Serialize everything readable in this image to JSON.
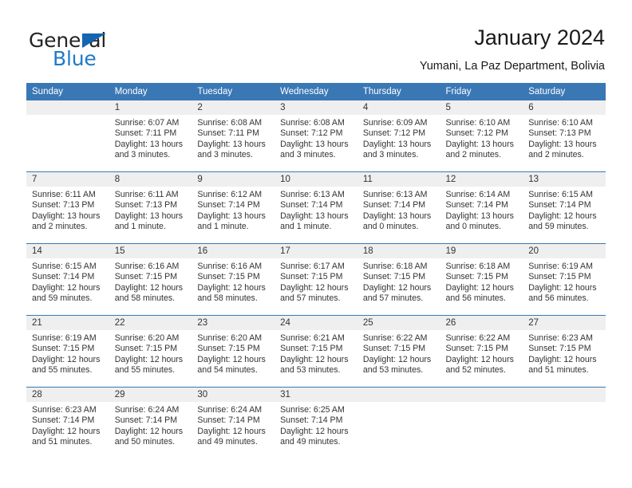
{
  "brand": {
    "name_part1": "General",
    "name_part2": "Blue",
    "triangle_color": "#1565b0",
    "blue_color": "#1f7ac9"
  },
  "header": {
    "title": "January 2024",
    "subtitle": "Yumani, La Paz Department, Bolivia"
  },
  "theme": {
    "header_row_bg": "#3a78b5",
    "daynum_band_bg": "#efefef",
    "row_separator": "#3a78b5",
    "text": "#333333"
  },
  "weekdays": [
    "Sunday",
    "Monday",
    "Tuesday",
    "Wednesday",
    "Thursday",
    "Friday",
    "Saturday"
  ],
  "labels": {
    "sunrise_prefix": "Sunrise:",
    "sunset_prefix": "Sunset:",
    "daylight_prefix": "Daylight:"
  },
  "weeks": [
    [
      {
        "day": "",
        "sunrise": "",
        "sunset": "",
        "daylight_line1": "",
        "daylight_line2": "",
        "empty": true
      },
      {
        "day": "1",
        "sunrise": "Sunrise: 6:07 AM",
        "sunset": "Sunset: 7:11 PM",
        "daylight_line1": "Daylight: 13 hours",
        "daylight_line2": "and 3 minutes.",
        "empty": false
      },
      {
        "day": "2",
        "sunrise": "Sunrise: 6:08 AM",
        "sunset": "Sunset: 7:11 PM",
        "daylight_line1": "Daylight: 13 hours",
        "daylight_line2": "and 3 minutes.",
        "empty": false
      },
      {
        "day": "3",
        "sunrise": "Sunrise: 6:08 AM",
        "sunset": "Sunset: 7:12 PM",
        "daylight_line1": "Daylight: 13 hours",
        "daylight_line2": "and 3 minutes.",
        "empty": false
      },
      {
        "day": "4",
        "sunrise": "Sunrise: 6:09 AM",
        "sunset": "Sunset: 7:12 PM",
        "daylight_line1": "Daylight: 13 hours",
        "daylight_line2": "and 3 minutes.",
        "empty": false
      },
      {
        "day": "5",
        "sunrise": "Sunrise: 6:10 AM",
        "sunset": "Sunset: 7:12 PM",
        "daylight_line1": "Daylight: 13 hours",
        "daylight_line2": "and 2 minutes.",
        "empty": false
      },
      {
        "day": "6",
        "sunrise": "Sunrise: 6:10 AM",
        "sunset": "Sunset: 7:13 PM",
        "daylight_line1": "Daylight: 13 hours",
        "daylight_line2": "and 2 minutes.",
        "empty": false
      }
    ],
    [
      {
        "day": "7",
        "sunrise": "Sunrise: 6:11 AM",
        "sunset": "Sunset: 7:13 PM",
        "daylight_line1": "Daylight: 13 hours",
        "daylight_line2": "and 2 minutes.",
        "empty": false
      },
      {
        "day": "8",
        "sunrise": "Sunrise: 6:11 AM",
        "sunset": "Sunset: 7:13 PM",
        "daylight_line1": "Daylight: 13 hours",
        "daylight_line2": "and 1 minute.",
        "empty": false
      },
      {
        "day": "9",
        "sunrise": "Sunrise: 6:12 AM",
        "sunset": "Sunset: 7:14 PM",
        "daylight_line1": "Daylight: 13 hours",
        "daylight_line2": "and 1 minute.",
        "empty": false
      },
      {
        "day": "10",
        "sunrise": "Sunrise: 6:13 AM",
        "sunset": "Sunset: 7:14 PM",
        "daylight_line1": "Daylight: 13 hours",
        "daylight_line2": "and 1 minute.",
        "empty": false
      },
      {
        "day": "11",
        "sunrise": "Sunrise: 6:13 AM",
        "sunset": "Sunset: 7:14 PM",
        "daylight_line1": "Daylight: 13 hours",
        "daylight_line2": "and 0 minutes.",
        "empty": false
      },
      {
        "day": "12",
        "sunrise": "Sunrise: 6:14 AM",
        "sunset": "Sunset: 7:14 PM",
        "daylight_line1": "Daylight: 13 hours",
        "daylight_line2": "and 0 minutes.",
        "empty": false
      },
      {
        "day": "13",
        "sunrise": "Sunrise: 6:15 AM",
        "sunset": "Sunset: 7:14 PM",
        "daylight_line1": "Daylight: 12 hours",
        "daylight_line2": "and 59 minutes.",
        "empty": false
      }
    ],
    [
      {
        "day": "14",
        "sunrise": "Sunrise: 6:15 AM",
        "sunset": "Sunset: 7:14 PM",
        "daylight_line1": "Daylight: 12 hours",
        "daylight_line2": "and 59 minutes.",
        "empty": false
      },
      {
        "day": "15",
        "sunrise": "Sunrise: 6:16 AM",
        "sunset": "Sunset: 7:15 PM",
        "daylight_line1": "Daylight: 12 hours",
        "daylight_line2": "and 58 minutes.",
        "empty": false
      },
      {
        "day": "16",
        "sunrise": "Sunrise: 6:16 AM",
        "sunset": "Sunset: 7:15 PM",
        "daylight_line1": "Daylight: 12 hours",
        "daylight_line2": "and 58 minutes.",
        "empty": false
      },
      {
        "day": "17",
        "sunrise": "Sunrise: 6:17 AM",
        "sunset": "Sunset: 7:15 PM",
        "daylight_line1": "Daylight: 12 hours",
        "daylight_line2": "and 57 minutes.",
        "empty": false
      },
      {
        "day": "18",
        "sunrise": "Sunrise: 6:18 AM",
        "sunset": "Sunset: 7:15 PM",
        "daylight_line1": "Daylight: 12 hours",
        "daylight_line2": "and 57 minutes.",
        "empty": false
      },
      {
        "day": "19",
        "sunrise": "Sunrise: 6:18 AM",
        "sunset": "Sunset: 7:15 PM",
        "daylight_line1": "Daylight: 12 hours",
        "daylight_line2": "and 56 minutes.",
        "empty": false
      },
      {
        "day": "20",
        "sunrise": "Sunrise: 6:19 AM",
        "sunset": "Sunset: 7:15 PM",
        "daylight_line1": "Daylight: 12 hours",
        "daylight_line2": "and 56 minutes.",
        "empty": false
      }
    ],
    [
      {
        "day": "21",
        "sunrise": "Sunrise: 6:19 AM",
        "sunset": "Sunset: 7:15 PM",
        "daylight_line1": "Daylight: 12 hours",
        "daylight_line2": "and 55 minutes.",
        "empty": false
      },
      {
        "day": "22",
        "sunrise": "Sunrise: 6:20 AM",
        "sunset": "Sunset: 7:15 PM",
        "daylight_line1": "Daylight: 12 hours",
        "daylight_line2": "and 55 minutes.",
        "empty": false
      },
      {
        "day": "23",
        "sunrise": "Sunrise: 6:20 AM",
        "sunset": "Sunset: 7:15 PM",
        "daylight_line1": "Daylight: 12 hours",
        "daylight_line2": "and 54 minutes.",
        "empty": false
      },
      {
        "day": "24",
        "sunrise": "Sunrise: 6:21 AM",
        "sunset": "Sunset: 7:15 PM",
        "daylight_line1": "Daylight: 12 hours",
        "daylight_line2": "and 53 minutes.",
        "empty": false
      },
      {
        "day": "25",
        "sunrise": "Sunrise: 6:22 AM",
        "sunset": "Sunset: 7:15 PM",
        "daylight_line1": "Daylight: 12 hours",
        "daylight_line2": "and 53 minutes.",
        "empty": false
      },
      {
        "day": "26",
        "sunrise": "Sunrise: 6:22 AM",
        "sunset": "Sunset: 7:15 PM",
        "daylight_line1": "Daylight: 12 hours",
        "daylight_line2": "and 52 minutes.",
        "empty": false
      },
      {
        "day": "27",
        "sunrise": "Sunrise: 6:23 AM",
        "sunset": "Sunset: 7:15 PM",
        "daylight_line1": "Daylight: 12 hours",
        "daylight_line2": "and 51 minutes.",
        "empty": false
      }
    ],
    [
      {
        "day": "28",
        "sunrise": "Sunrise: 6:23 AM",
        "sunset": "Sunset: 7:14 PM",
        "daylight_line1": "Daylight: 12 hours",
        "daylight_line2": "and 51 minutes.",
        "empty": false
      },
      {
        "day": "29",
        "sunrise": "Sunrise: 6:24 AM",
        "sunset": "Sunset: 7:14 PM",
        "daylight_line1": "Daylight: 12 hours",
        "daylight_line2": "and 50 minutes.",
        "empty": false
      },
      {
        "day": "30",
        "sunrise": "Sunrise: 6:24 AM",
        "sunset": "Sunset: 7:14 PM",
        "daylight_line1": "Daylight: 12 hours",
        "daylight_line2": "and 49 minutes.",
        "empty": false
      },
      {
        "day": "31",
        "sunrise": "Sunrise: 6:25 AM",
        "sunset": "Sunset: 7:14 PM",
        "daylight_line1": "Daylight: 12 hours",
        "daylight_line2": "and 49 minutes.",
        "empty": false
      },
      {
        "day": "",
        "sunrise": "",
        "sunset": "",
        "daylight_line1": "",
        "daylight_line2": "",
        "empty": true
      },
      {
        "day": "",
        "sunrise": "",
        "sunset": "",
        "daylight_line1": "",
        "daylight_line2": "",
        "empty": true
      },
      {
        "day": "",
        "sunrise": "",
        "sunset": "",
        "daylight_line1": "",
        "daylight_line2": "",
        "empty": true
      }
    ]
  ]
}
